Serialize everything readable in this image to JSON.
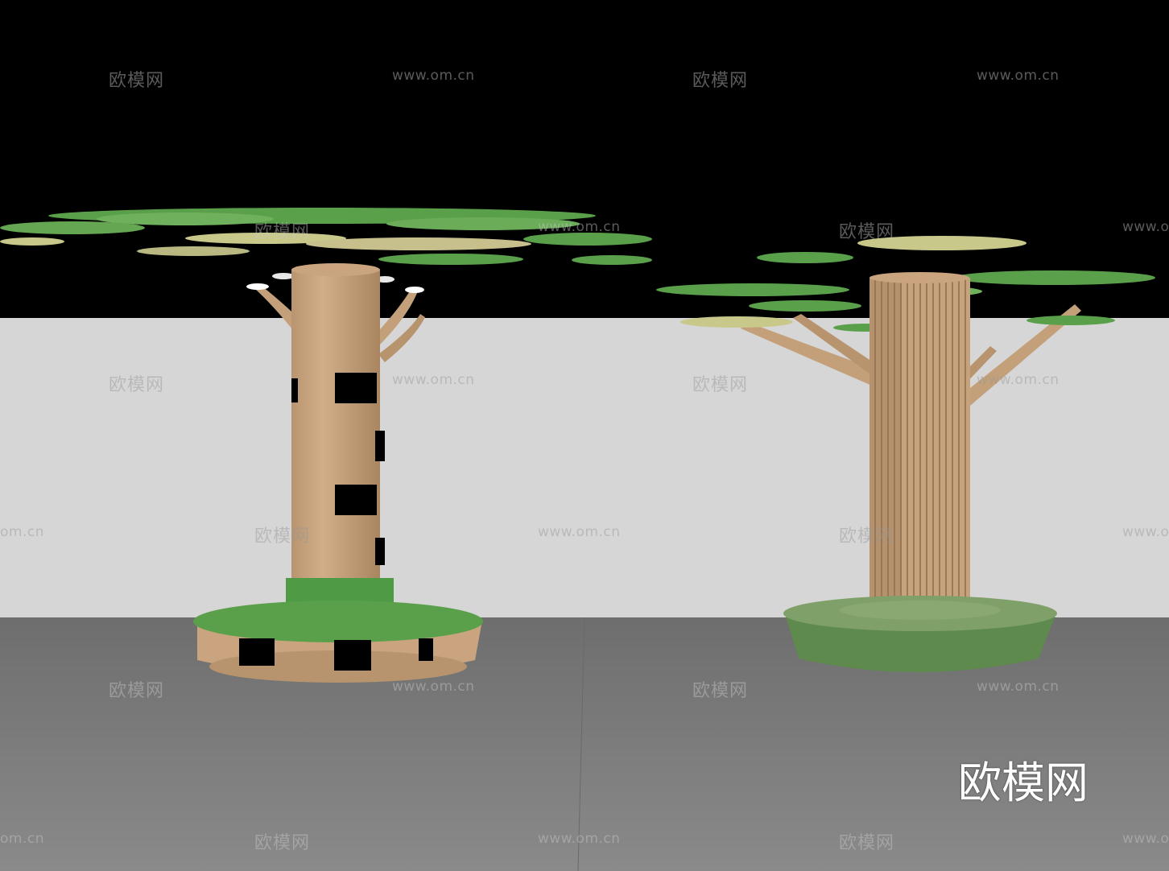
{
  "watermark": {
    "brand_text": "欧模网",
    "url_text": "www.om.cn",
    "url_short": "om.cn"
  },
  "logo_text": "欧模网",
  "colors": {
    "sky": "#000000",
    "wall": "#d6d6d6",
    "floor": "#7a7a7a",
    "trunk": "#c9a47e",
    "trunk_dark": "#a8845f",
    "leaf": "#5aa04a",
    "leaf_light": "#c8c88a",
    "planter_green": "#5f8a4e"
  },
  "scene": {
    "left_model": "tree-column-with-shelves",
    "right_model": "tree-with-branches-in-planter"
  }
}
